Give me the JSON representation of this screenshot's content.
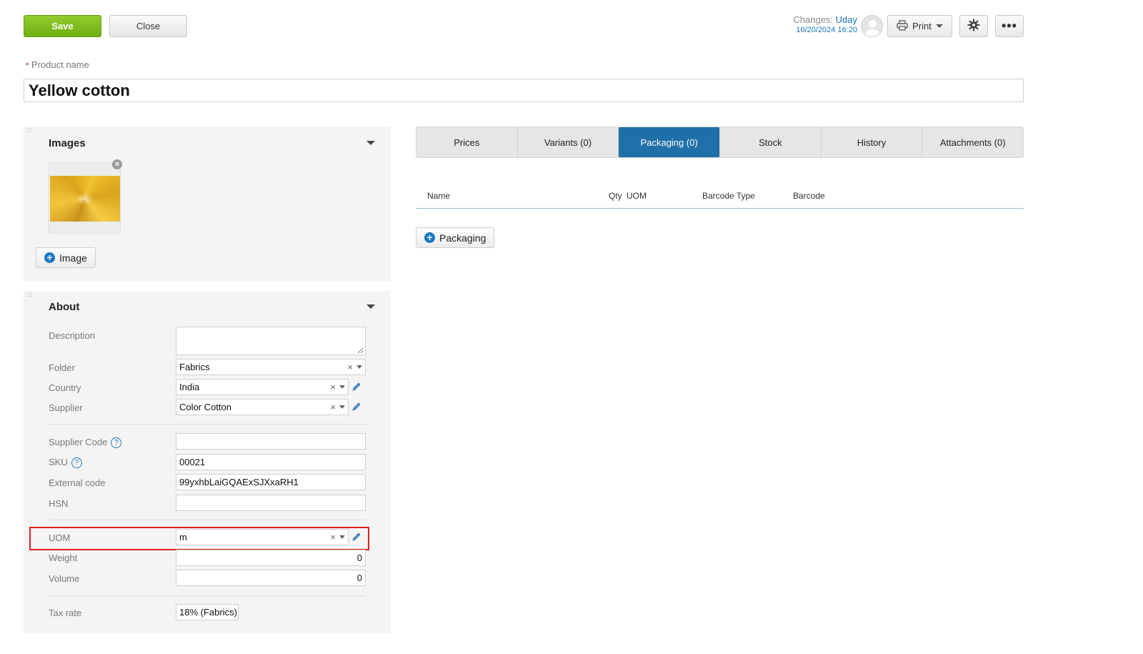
{
  "toolbar": {
    "save_label": "Save",
    "close_label": "Close",
    "changes_label": "Changes:",
    "changes_user": "Uday",
    "changes_date": "10/20/2024 16:20",
    "print_label": "Print",
    "more_label": "•••"
  },
  "product": {
    "required_mark": "*",
    "name_label": "Product name",
    "name_value": "Yellow cotton"
  },
  "images_panel": {
    "title": "Images",
    "add_image_label": "Image",
    "remove_label": "×"
  },
  "about_panel": {
    "title": "About",
    "description_label": "Description",
    "description_value": "",
    "folder_label": "Folder",
    "folder_value": "Fabrics",
    "country_label": "Country",
    "country_value": "India",
    "supplier_label": "Supplier",
    "supplier_value": "Color Cotton",
    "supplier_code_label": "Supplier Code",
    "supplier_code_value": "",
    "sku_label": "SKU",
    "sku_value": "00021",
    "external_code_label": "External code",
    "external_code_value": "99yxhbLaiGQAExSJXxaRH1",
    "hsn_label": "HSN",
    "hsn_value": "",
    "uom_label": "UOM",
    "uom_value": "m",
    "weight_label": "Weight",
    "weight_value": "0",
    "volume_label": "Volume",
    "volume_value": "0",
    "tax_rate_label": "Tax rate",
    "tax_rate_value": "18% (Fabrics)",
    "help_glyph": "?",
    "clear_glyph": "×"
  },
  "tabs": [
    {
      "label": "Prices"
    },
    {
      "label": "Variants (0)"
    },
    {
      "label": "Packaging (0)"
    },
    {
      "label": "Stock"
    },
    {
      "label": "History"
    },
    {
      "label": "Attachments (0)"
    }
  ],
  "packaging_table": {
    "columns": [
      "Name",
      "Qty",
      "UOM",
      "Barcode Type",
      "Barcode"
    ],
    "add_label": "Packaging"
  },
  "colors": {
    "save_green": "#7bbb1d",
    "active_tab": "#1f6fa8",
    "link_blue": "#1a75b8",
    "highlight_red": "#e01e1e"
  },
  "icons": {
    "print": "printer-icon",
    "settings": "gear-icon",
    "more": "ellipsis-icon",
    "edit": "pencil-icon",
    "add": "plus-circle-icon",
    "collapse": "caret-down-icon",
    "drag": "drag-handle-icon"
  }
}
